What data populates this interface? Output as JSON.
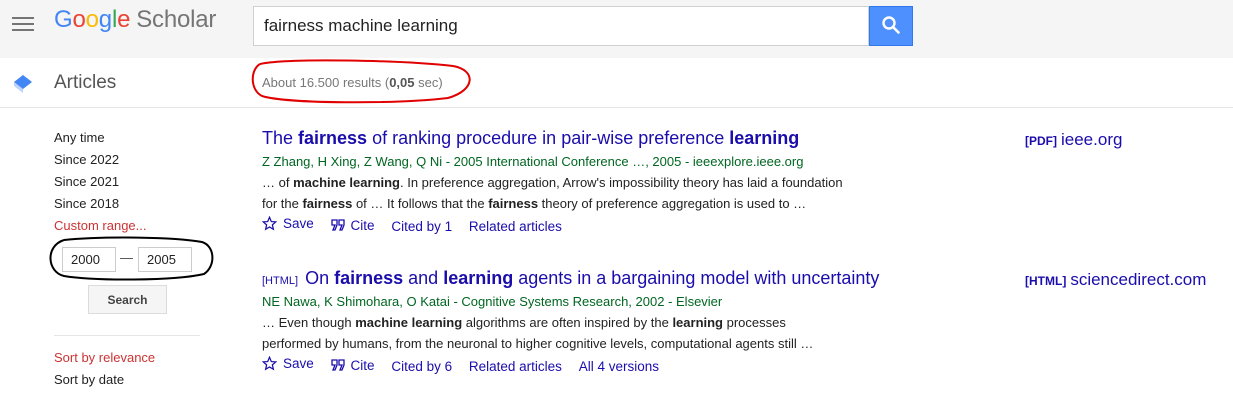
{
  "header": {
    "logo": {
      "g1": "G",
      "o1": "o",
      "o2": "o",
      "g2": "g",
      "l": "l",
      "e": "e",
      "scholar": "Scholar"
    },
    "search_value": "fairness machine learning"
  },
  "subbar": {
    "section_label": "Articles",
    "results_prefix": "About 16.500 results (",
    "results_time": "0,05",
    "results_suffix": " sec)"
  },
  "sidebar": {
    "time_filters": [
      "Any time",
      "Since 2022",
      "Since 2021",
      "Since 2018",
      "Custom range..."
    ],
    "range_from": "2000",
    "range_dash": "—",
    "range_to": "2005",
    "search_button": "Search",
    "sort_relevance": "Sort by relevance",
    "sort_date": "Sort by date"
  },
  "results": [
    {
      "title_parts": [
        {
          "t": "The ",
          "b": false
        },
        {
          "t": "fairness",
          "b": true
        },
        {
          "t": " of ranking procedure in pair-wise preference ",
          "b": false
        },
        {
          "t": "learning",
          "b": true
        }
      ],
      "format_tag": "",
      "authors": "Z Zhang, H Xing, Z Wang, Q Ni - 2005 International Conference …, 2005 - ieeexplore.ieee.org",
      "snippet_line1": [
        {
          "t": "… of ",
          "b": false
        },
        {
          "t": "machine learning",
          "b": true
        },
        {
          "t": ". In preference aggregation, Arrow's impossibility theory has laid a foundation",
          "b": false
        }
      ],
      "snippet_line2": [
        {
          "t": "for the ",
          "b": false
        },
        {
          "t": "fairness",
          "b": true
        },
        {
          "t": " of … It follows that the ",
          "b": false
        },
        {
          "t": "fairness",
          "b": true
        },
        {
          "t": " theory of preference aggregation is used to …",
          "b": false
        }
      ],
      "actions": {
        "save": "Save",
        "cite": "Cite",
        "cited_by": "Cited by 1",
        "related": "Related articles",
        "versions": ""
      },
      "side_link": {
        "tag": "[PDF]",
        "domain": "ieee.org"
      }
    },
    {
      "title_parts": [
        {
          "t": "On ",
          "b": false
        },
        {
          "t": "fairness",
          "b": true
        },
        {
          "t": " and ",
          "b": false
        },
        {
          "t": "learning",
          "b": true
        },
        {
          "t": " agents in a bargaining model with uncertainty",
          "b": false
        }
      ],
      "format_tag": "[HTML]",
      "authors": "NE Nawa, K Shimohara, O Katai - Cognitive Systems Research, 2002 - Elsevier",
      "snippet_line1": [
        {
          "t": "… Even though ",
          "b": false
        },
        {
          "t": "machine learning",
          "b": true
        },
        {
          "t": " algorithms are often inspired by the ",
          "b": false
        },
        {
          "t": "learning",
          "b": true
        },
        {
          "t": " processes",
          "b": false
        }
      ],
      "snippet_line2": [
        {
          "t": "performed by humans, from the neuronal to higher cognitive levels, computational agents still …",
          "b": false
        }
      ],
      "actions": {
        "save": "Save",
        "cite": "Cite",
        "cited_by": "Cited by 6",
        "related": "Related articles",
        "versions": "All 4 versions"
      },
      "side_link": {
        "tag": "[HTML]",
        "domain": "sciencedirect.com"
      }
    }
  ],
  "colors": {
    "accent": "#4d90fe",
    "link": "#1a0dab",
    "authors": "#006621",
    "annotation_red": "#e00000"
  }
}
